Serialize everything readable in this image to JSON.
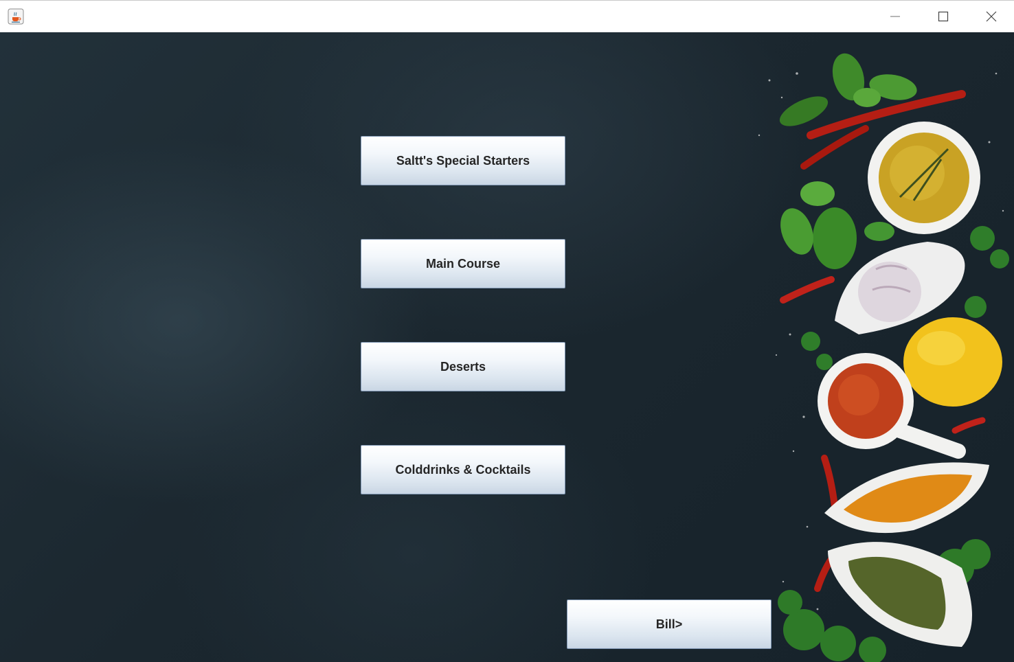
{
  "titlebar": {
    "app_icon": "java-cup-icon",
    "controls": {
      "minimize": "minimize-icon",
      "maximize": "maximize-icon",
      "close": "close-icon"
    }
  },
  "menu": {
    "starters_label": "Saltt's Special Starters",
    "main_course_label": "Main Course",
    "desserts_label": "Deserts",
    "drinks_label": "Colddrinks & Cocktails"
  },
  "bill": {
    "label": "Bill>"
  },
  "colors": {
    "background": "#1b272f",
    "button_top": "#ffffff",
    "button_bottom": "#c9d6e4",
    "button_border": "#7f96b3",
    "button_text": "#262626"
  }
}
